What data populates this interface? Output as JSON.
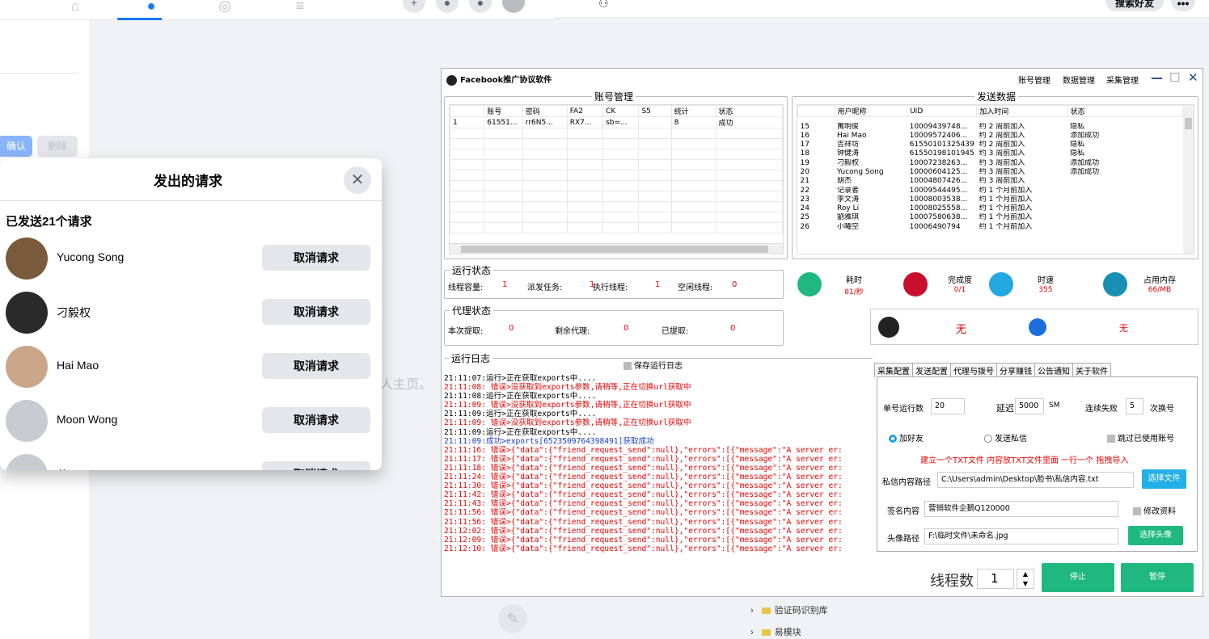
{
  "facebook": {
    "nav_icons": [
      "home-icon",
      "friends-icon",
      "groups-icon",
      "menu-icon"
    ],
    "side_confirm": "确认",
    "side_delete": "删除",
    "profile_hint": "人主页。",
    "search_btn": "搜索好友",
    "more_btn": "•••"
  },
  "modal": {
    "title": "发出的请求",
    "close": "✕",
    "sent_count": "已发送21个请求",
    "requests": [
      {
        "name": "Yucong Song",
        "button": "取消请求",
        "avatar_color": "#7a5a3c"
      },
      {
        "name": "刁毅权",
        "button": "取消请求",
        "avatar_color": "#2a2a2a"
      },
      {
        "name": "Hai Mao",
        "button": "取消请求",
        "avatar_color": "#c9a58a"
      },
      {
        "name": "Moon Wong",
        "button": "取消请求",
        "avatar_color": "#c8ccd2"
      },
      {
        "name": "黄...",
        "button": "取消请求",
        "avatar_color": "#c8ccd2"
      }
    ]
  },
  "tree": [
    {
      "label": "验证码识别库"
    },
    {
      "label": "易模块"
    }
  ],
  "software": {
    "title": "Facebook推广协议软件",
    "menu": [
      "账号管理",
      "数据管理",
      "采集管理"
    ],
    "win_buttons": [
      "—",
      "☐",
      "✕"
    ],
    "account_group": "账号管理",
    "account_headers": [
      "",
      "账号",
      "密码",
      "FA2",
      "CK",
      "S5",
      "统计",
      "状态"
    ],
    "account_rows": [
      [
        "1",
        "61551...",
        "rr6N5...",
        "RX7...",
        "sb=...",
        "",
        "8",
        "成功"
      ]
    ],
    "send_group": "发送数据",
    "send_headers": [
      "",
      "用户昵称",
      "UID",
      "加入时间",
      "状态"
    ],
    "send_rows": [
      [
        "15",
        "萬明俊",
        "10009439748...",
        "约 2 周前加入",
        "隐私"
      ],
      [
        "16",
        "Hai Mao",
        "10009572406...",
        "约 2 周前加入",
        "添加成功"
      ],
      [
        "17",
        "吉祥坊",
        "61550101325439",
        "约 2 周前加入",
        "隐私"
      ],
      [
        "18",
        "钟健涛",
        "61550198101945",
        "约 3 周前加入",
        "隐私"
      ],
      [
        "19",
        "刁毅权",
        "10007238263...",
        "约 3 周前加入",
        "添加成功"
      ],
      [
        "20",
        "Yucong Song",
        "10000604125...",
        "约 3 周前加入",
        "添加成功"
      ],
      [
        "21",
        "胡杰",
        "10004807426...",
        "约 3 周前加入",
        ""
      ],
      [
        "22",
        "记录者",
        "10009544495...",
        "约 1 个月前加入",
        ""
      ],
      [
        "23",
        "李文涛",
        "10008003538...",
        "约 1 个月前加入",
        ""
      ],
      [
        "24",
        "Roy Li",
        "10008025558...",
        "约 1 个月前加入",
        ""
      ],
      [
        "25",
        "劉雅琪",
        "10007580638...",
        "约 1 个月前加入",
        ""
      ],
      [
        "26",
        "小曦空",
        "10006490794",
        "约 1 个月前加入",
        ""
      ]
    ],
    "run_group": "运行状态",
    "run_stats": [
      {
        "label": "线程容量:",
        "value": "1"
      },
      {
        "label": "派发任务:",
        "value": "1"
      },
      {
        "label": "执行线程:",
        "value": "1"
      },
      {
        "label": "空闲线程:",
        "value": "0"
      }
    ],
    "metrics": [
      {
        "label": "耗时",
        "value": "81/秒",
        "icon": "clock-icon",
        "color": "#1fb97f"
      },
      {
        "label": "完成度",
        "value": "0/1",
        "icon": "hourglass-icon",
        "color": "#c8102e"
      },
      {
        "label": "时速",
        "value": "355",
        "icon": "speedometer-icon",
        "color": "#23a8e0"
      },
      {
        "label": "占用内存",
        "value": "66/MB",
        "icon": "memory-icon",
        "color": "#1a8fb5"
      }
    ],
    "proxy_group": "代理状态",
    "proxy_stats": [
      {
        "label": "本次提取:",
        "value": "0"
      },
      {
        "label": "剩余代理:",
        "value": "0"
      },
      {
        "label": "已提取:",
        "value": "0"
      }
    ],
    "status_none_1": "无",
    "status_none_2": "无",
    "log_group": "运行日志",
    "save_log": "保存运行日志",
    "log_lines": [
      {
        "text": "21:11:07:运行>正在获取exports中....",
        "color": "#000"
      },
      {
        "text": "21:11:08: 错误>没获取到exports参数,请稍等,正在切换url获取中",
        "color": "#e00"
      },
      {
        "text": "21:11:08:运行>正在获取exports中....",
        "color": "#000"
      },
      {
        "text": "21:11:09: 错误>没获取到exports参数,请稍等,正在切换url获取中",
        "color": "#e00"
      },
      {
        "text": "21:11:09:运行>正在获取exports中....",
        "color": "#000"
      },
      {
        "text": "21:11:09: 错误>没获取到exports参数,请稍等,正在切换url获取中",
        "color": "#e00"
      },
      {
        "text": "21:11:09:运行>正在获取exports中....",
        "color": "#000"
      },
      {
        "text": "21:11:09:成功>exports[6523509764398491]获取成功",
        "color": "#1a3ccc"
      },
      {
        "text": "21:11:16: 错误>{\"data\":{\"friend_request_send\":null},\"errors\":[{\"message\":\"A server er:",
        "color": "#e00"
      },
      {
        "text": "21:11:17: 错误>{\"data\":{\"friend_request_send\":null},\"errors\":[{\"message\":\"A server er:",
        "color": "#e00"
      },
      {
        "text": "21:11:18: 错误>{\"data\":{\"friend_request_send\":null},\"errors\":[{\"message\":\"A server er:",
        "color": "#e00"
      },
      {
        "text": "21:11:24: 错误>{\"data\":{\"friend_request_send\":null},\"errors\":[{\"message\":\"A server er:",
        "color": "#e00"
      },
      {
        "text": "21:11:30: 错误>{\"data\":{\"friend_request_send\":null},\"errors\":[{\"message\":\"A server er:",
        "color": "#e00"
      },
      {
        "text": "21:11:42: 错误>{\"data\":{\"friend_request_send\":null},\"errors\":[{\"message\":\"A server er:",
        "color": "#e00"
      },
      {
        "text": "21:11:43: 错误>{\"data\":{\"friend_request_send\":null},\"errors\":[{\"message\":\"A server er:",
        "color": "#e00"
      },
      {
        "text": "21:11:56: 错误>{\"data\":{\"friend_request_send\":null},\"errors\":[{\"message\":\"A server er:",
        "color": "#e00"
      },
      {
        "text": "21:11:56: 错误>{\"data\":{\"friend_request_send\":null},\"errors\":[{\"message\":\"A server er:",
        "color": "#e00"
      },
      {
        "text": "21:12:02: 错误>{\"data\":{\"friend_request_send\":null},\"errors\":[{\"message\":\"A server er:",
        "color": "#e00"
      },
      {
        "text": "21:12:09: 错误>{\"data\":{\"friend_request_send\":null},\"errors\":[{\"message\":\"A server er:",
        "color": "#e00"
      },
      {
        "text": "21:12:10: 错误>{\"data\":{\"friend_request_send\":null},\"errors\":[{\"message\":\"A server er:",
        "color": "#e00"
      }
    ],
    "tabs": [
      "采集配置",
      "发送配置",
      "代理与拨号",
      "分享赚钱",
      "公告通知",
      "关于软件"
    ],
    "active_tab": 1,
    "cfg": {
      "per_account_label": "单号运行数",
      "per_account_value": "20",
      "delay_label": "延迟",
      "delay_value": "5000",
      "delay_unit": "SM",
      "fail_label": "连续失败",
      "fail_value": "5",
      "fail_unit": "次换号",
      "radio_add": "加好友",
      "radio_msg": "发送私信",
      "skip_used": "跳过已使用账号",
      "hint": "建立一个TXT文件 内容放TXT文件里面 一行一个 拖拽导入",
      "msg_path_label": "私信内容路径",
      "msg_path_value": "C:\\Users\\admin\\Desktop\\脸书\\私信内容.txt",
      "choose_file": "选择文件",
      "sig_label": "签名内容",
      "sig_value": "营销软件企鹅Q120000",
      "edit_profile": "修改资料",
      "avatar_label": "头像路径",
      "avatar_value": "F:\\临时文件\\未命名.jpg",
      "choose_avatar": "选择头像",
      "threads_label": "线程数",
      "threads_value": "1",
      "stop": "停止",
      "pause": "暂停"
    }
  }
}
